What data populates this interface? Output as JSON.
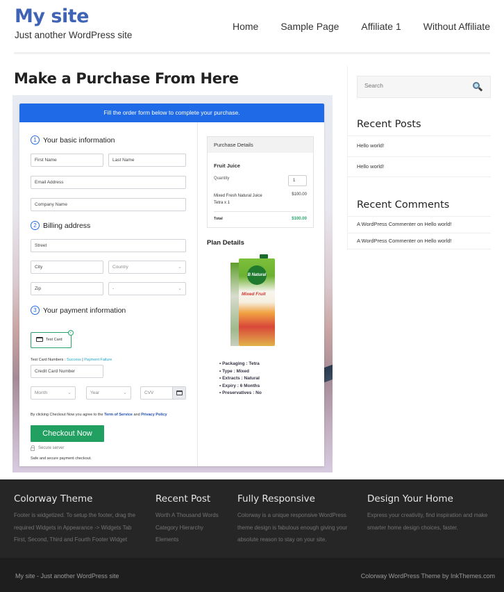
{
  "header": {
    "site_title": "My site",
    "tagline": "Just another WordPress site",
    "nav": [
      "Home",
      "Sample Page",
      "Affiliate 1",
      "Without Affiliate"
    ]
  },
  "main": {
    "page_title": "Make a Purchase From Here",
    "form": {
      "banner": "Fill the order form below to complete your purchase.",
      "steps": [
        {
          "num": "1",
          "label": "Your basic information"
        },
        {
          "num": "2",
          "label": "Billing address"
        },
        {
          "num": "3",
          "label": "Your payment information"
        }
      ],
      "fields": {
        "first_name": "First Name",
        "last_name": "Last Name",
        "email": "Email Address",
        "company": "Company Name",
        "street": "Street",
        "city": "City",
        "country": "Country",
        "zip": "Zip",
        "state": "-",
        "card_number": "Credit Card Number",
        "month": "Month",
        "year": "Year",
        "cvv": "CVV"
      },
      "payment_option": "Test Card",
      "test_card_label": "Test Card Numbers : ",
      "test_success": "Success",
      "test_separator": " | ",
      "test_failure": "Payment Failure",
      "agree_prefix": "By clicking Checkout Now you agree to the ",
      "terms": "Term of Service",
      "agree_and": " and ",
      "privacy": "Privacy Policy",
      "checkout_button": "Checkout Now",
      "secure_server": "Secure server",
      "safe_text": "Safe and secure payment checkout."
    },
    "purchase_details": {
      "title": "Purchase Details",
      "product": "Fruit Juice",
      "quantity_label": "Quantity",
      "quantity": "1",
      "item": "Mixed Fresh Natural Juice Tetra x 1",
      "item_price": "$100.00",
      "total_label": "Total",
      "total": "$100.00",
      "total_color": "#25a56a"
    },
    "plan_details": {
      "title": "Plan Details",
      "image_badge": "B Natural",
      "image_flavor": "Mixed Fruit",
      "features": [
        "Packaging : Tetra",
        "Type : Mixed",
        "Extracts : Natural",
        "Expiry : 6 Months",
        "Preservatives : No"
      ]
    }
  },
  "sidebar": {
    "search_placeholder": "Search",
    "recent_posts_title": "Recent Posts",
    "recent_posts": [
      "Hello world!",
      "Hello world!"
    ],
    "recent_comments_title": "Recent Comments",
    "recent_comments": [
      "A WordPress Commenter on Hello world!",
      "A WordPress Commenter on Hello world!"
    ]
  },
  "footer": {
    "columns": [
      {
        "title": "Colorway Theme",
        "lines": [
          "Footer is widgetized. To setup the footer, drag the",
          "required Widgets in Appearance -> Widgets Tab",
          "First, Second, Third and Fourth Footer Widget"
        ]
      },
      {
        "title": "Recent Post",
        "lines": [
          "Worth A Thousand Words",
          "Category Hierarchy",
          "Elements"
        ]
      },
      {
        "title": "Fully Responsive",
        "lines": [
          "Colorway is a unique responsive WordPress",
          "theme design is fabulous enough giving your",
          "absolute reason to stay on your site."
        ]
      },
      {
        "title": "Design Your Home",
        "lines": [
          "Express your creativity, find inspiration and make",
          "smarter home design choices, faster."
        ]
      }
    ],
    "bottom_left": "My site - Just another WordPress site",
    "bottom_right": "Colorway WordPress Theme by InkThemes.com"
  },
  "colors": {
    "brand": "#3f63b5",
    "form_banner": "#1f6ae6",
    "checkout": "#22a061"
  }
}
